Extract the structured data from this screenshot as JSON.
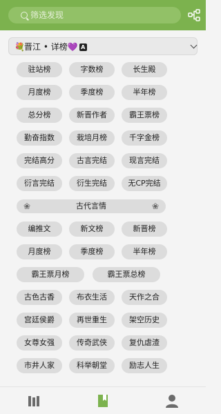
{
  "search": {
    "placeholder": "筛选发现"
  },
  "selector": {
    "text": "晋江 • 详榜",
    "heart": "💜",
    "badge": "A",
    "icon": "bouquet-icon"
  },
  "rows": [
    [
      "驻站榜",
      "字数榜",
      "长生殿"
    ],
    [
      "月度榜",
      "季度榜",
      "半年榜"
    ],
    [
      "总分榜",
      "新晋作者",
      "霸王票榜"
    ],
    [
      "勤奋指数",
      "栽培月榜",
      "千字金榜"
    ],
    [
      "完结高分",
      "古言完结",
      "现言完结"
    ],
    [
      "衍言完结",
      "衍生完结",
      "无CP完结"
    ]
  ],
  "section": {
    "title": "古代言情",
    "left_icon": "❀",
    "right_icon": "❀"
  },
  "rows2": [
    [
      "编推文",
      "新文榜",
      "新晋榜"
    ],
    [
      "月度榜",
      "季度榜",
      "半年榜"
    ]
  ],
  "rows3": [
    [
      "霸王票月榜",
      "霸王票总榜"
    ]
  ],
  "rows4": [
    [
      "古色古香",
      "布衣生活",
      "天作之合"
    ],
    [
      "宫廷侯爵",
      "再世重生",
      "架空历史"
    ],
    [
      "女尊女强",
      "传奇武侠",
      "复仇虐渣"
    ],
    [
      "市井人家",
      "科举朝堂",
      "励志人生"
    ]
  ],
  "nav": {
    "icons": [
      "bookshelf-icon",
      "discover-book-icon",
      "profile-icon"
    ]
  },
  "colors": {
    "accent": "#7cb24e",
    "pill": "#dcdcdc",
    "active_nav": "#7cb24e",
    "inactive_nav": "#6b6b6b"
  }
}
